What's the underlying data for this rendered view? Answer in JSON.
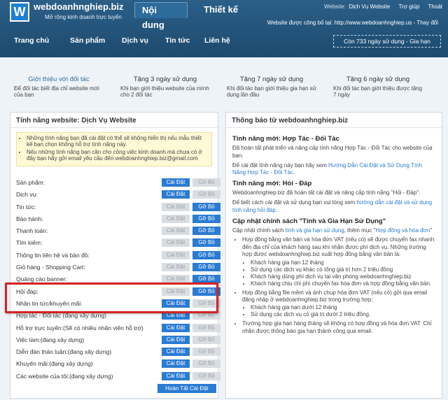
{
  "header": {
    "site_name": "webdoanhnghiep.biz",
    "tagline": "Mở rộng kinh doanh trực tuyến",
    "tabs": [
      {
        "label": "Nội dung"
      },
      {
        "label": "Thiết kế"
      }
    ],
    "website_prefix": "Website:",
    "website_name": "Dịch Vụ Website",
    "help": "Trợ giúp",
    "logout": "Thoát",
    "public_text": "Website được công bố tại: http://www.webdoanhnghiep.us - Thay đổi",
    "nav": [
      "Trang chủ",
      "Sản phẩm",
      "Dịch vụ",
      "Tin tức",
      "Liên hệ"
    ],
    "used_days": "Còn 733 ngày sử dụng - Gia hạn"
  },
  "promo": [
    {
      "title": "Giới thiệu với đối tác",
      "desc": "Để đối tác biết địa chỉ website mới của bạn"
    },
    {
      "title": "Tặng 3 ngày sử dụng",
      "desc": "Khi bạn giới thiệu website của mình cho 2 đối tác"
    },
    {
      "title": "Tặng 7 ngày sử dụng",
      "desc": "Khi đối tác bạn giới thiệu gia hạn sử dụng lần đầu"
    },
    {
      "title": "Tặng 6 ngày sử dụng",
      "desc": "Khi đối tác bạn giới thiệu được tặng 7 ngày"
    }
  ],
  "left": {
    "title": "Tính năng website: Dịch Vụ Website",
    "notices": [
      "Những tính năng bạn đã cài đặt có thể sẽ không hiển thị nếu mẫu thiết kế bạn chọn không hỗ trợ tính năng này.",
      "Nếu những tính năng bạn cần cho công việc kinh doanh mà chưa có ở đây bạn hãy gởi email yêu cầu đến webdoanhnghiep.biz@gmail.com"
    ],
    "install_label": "Cài Đặt",
    "remove_label": "Gỡ Bỏ",
    "features": [
      {
        "label": "Sản phẩm:",
        "installed": false
      },
      {
        "label": "Dịch vụ:",
        "installed": false
      },
      {
        "label": "Tin tức:",
        "installed": true
      },
      {
        "label": "Bảo hành:",
        "installed": true
      },
      {
        "label": "Thanh toán:",
        "installed": true
      },
      {
        "label": "Tìm kiếm:",
        "installed": true
      },
      {
        "label": "Thông tin liên hệ và bản đồ:",
        "installed": true
      },
      {
        "label": "Giỏ hàng - Shopping Cart:",
        "installed": true
      },
      {
        "label": "Quảng cáo banner:",
        "installed": true
      },
      {
        "label": "Hỏi đáp:",
        "installed": true
      },
      {
        "label": "Nhận tin tức/khuyến mãi:",
        "installed": false
      },
      {
        "label": "Hợp tác - Đối tác (đang xây dựng)",
        "installed": false
      },
      {
        "label": "Hỗ trợ trực tuyến:(Sẽ có nhiều nhân viên hỗ trợ)",
        "installed": false
      },
      {
        "label": "Việc làm:(đang xây dựng)",
        "installed": false
      },
      {
        "label": "Diễn đàn thảo luận:(đang xây dựng)",
        "installed": false
      },
      {
        "label": "Khuyến mãi:(đang xây dựng)",
        "installed": false
      },
      {
        "label": "Các website của tôi:(đang xây dựng)",
        "installed": false
      }
    ],
    "complete_label": "Hoàn Tất Cài Đặt"
  },
  "right": {
    "title": "Thông báo từ webdoanhnghiep.biz",
    "h1": "Tính năng mới: Hợp Tác - Đối Tác",
    "p1": "Đã hoàn tất phát triển và nâng cấp tính năng Hợp Tác - Đối Tác cho website của bạn.",
    "p2_prefix": "Để cài đặt tính năng này bạn hãy xem ",
    "p2_link": "Hướng Dẫn Cài Đặt và Sử Dụng Tính Năng Hợp Tác - Đối Tác.",
    "h2": "Tính năng mới: Hỏi - Đáp",
    "p3": "Webdoanhnghiep.biz đã hoàn tất cài đặt và nâng cấp tính năng \"Hỏi - Đáp\".",
    "p4_prefix": "Để biết cách cài đặt và sử dụng bạn vui lòng xem ",
    "p4_link": "hướng dẫn cài đặt và sử dụng tính năng hỏi đáp.",
    "h3": "Cập nhật chính sách \"Tính và Gia Hạn Sử Dụng\"",
    "p5_a": "Cập nhật chính sách ",
    "p5_link1": "tính và gia hạn sử dụng",
    "p5_b": ", thêm mục \"",
    "p5_link2": "Hợp đồng và hóa đơn",
    "p5_c": "\"",
    "bullet1": "Hợp đồng bằng văn bản và hóa đơn VAT (nếu có) sẽ được chuyển fax nhanh đến địa chỉ của khách hàng sau khi nhận được phí dịch vụ. Những trường hợp được webdoanhnghiep.biz xuất hợp đồng bằng văn bản là:",
    "bullet1_sub": [
      "Khách hàng gia hạn 12 tháng",
      "Sử dụng các dịch vụ khác có tổng giá trị hơn 2 triệu đồng",
      "Khách hàng dùng phí dịch vụ tại văn phòng webdoanhnghiep.biz",
      "Khách hàng chịu chi phí chuyển fax hóa đơn và hợp đồng bằng văn bản."
    ],
    "bullet2": "Hợp đồng bằng file mềm và ảnh chụp hóa đơn VAT (nếu có) gởi qua email đăng nhập ở webdoanhnghiep.biz trong trường hợp:",
    "bullet2_sub": [
      "Khách hàng gia hạn dưới 12 tháng",
      "Sử dụng các dịch vụ có giá trị dưới 2 triệu đồng."
    ],
    "bullet3": "Trường hợp gia hạn hàng tháng sẽ không có hợp đồng và hóa đơn VAT. Chỉ nhận được thông báo gia hạn thành công qua email."
  },
  "colors": {
    "accent": "#2a7bd2",
    "header": "#245680",
    "highlight": "#d62222"
  }
}
